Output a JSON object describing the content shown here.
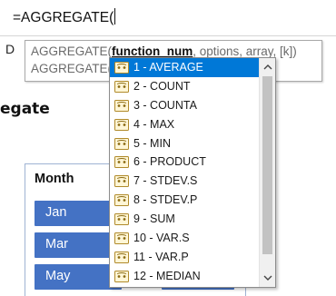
{
  "formula_bar": {
    "text": "=AGGREGATE("
  },
  "sheet": {
    "cell_text": "D",
    "title_partial": "egate"
  },
  "slicer": {
    "header": "Month",
    "items": [
      "Jan",
      "Mar",
      "May"
    ]
  },
  "tooltip": {
    "line1_prefix": "AGGREGATE(",
    "line1_bold": "function_num",
    "line1_suffix": ", options, array, [k])",
    "line2_prefix": "AGGREGATE(",
    "line2_suffix": ", ...)"
  },
  "dropdown": {
    "items": [
      "1 - AVERAGE",
      "2 - COUNT",
      "3 - COUNTA",
      "4 - MAX",
      "5 - MIN",
      "6 - PRODUCT",
      "7 - STDEV.S",
      "8 - STDEV.P",
      "9 - SUM",
      "10 - VAR.S",
      "11 - VAR.P",
      "12 - MEDIAN"
    ],
    "selected_index": 0
  },
  "colors": {
    "selected_bg": "#0078d7",
    "slicer_item_bg": "#4472c4"
  }
}
